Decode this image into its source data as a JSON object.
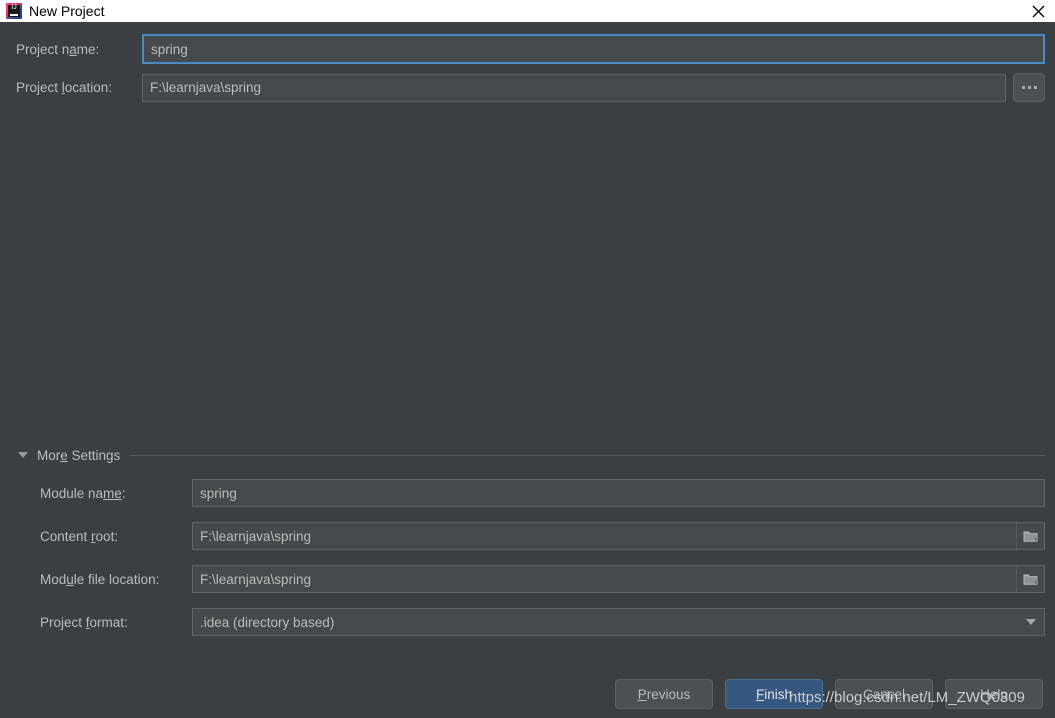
{
  "window": {
    "title": "New Project",
    "icon": "intellij-idea-icon",
    "close_label": "close-icon"
  },
  "top_form": {
    "project_name": {
      "label_before": "Project n",
      "label_mnemonic": "a",
      "label_after": "me:",
      "full_label": "Project name:",
      "value": "spring",
      "focused": true
    },
    "project_location": {
      "label_before": "Project ",
      "label_mnemonic": "l",
      "label_after": "ocation:",
      "full_label": "Project location:",
      "value": "F:\\learnjava\\spring"
    },
    "browse_button": {
      "label": "...",
      "name": "browse-button"
    }
  },
  "more_settings": {
    "label_before": "Mor",
    "label_mnemonic": "e",
    "label_after": " Settings",
    "full_label": "More Settings",
    "expanded": true,
    "rows": [
      {
        "label_before": "Module na",
        "label_mnemonic": "me",
        "label_after": ":",
        "full_label": "Module name:",
        "value": "spring",
        "control": "textfield"
      },
      {
        "label_before": "Content ",
        "label_mnemonic": "r",
        "label_after": "oot:",
        "full_label": "Content root:",
        "value": "F:\\learnjava\\spring",
        "control": "textfield-with-folder"
      },
      {
        "label_before": "Mod",
        "label_mnemonic": "u",
        "label_after": "le file location:",
        "full_label": "Module file location:",
        "value": "F:\\learnjava\\spring",
        "control": "textfield-with-folder"
      },
      {
        "label_before": "Project ",
        "label_mnemonic": "f",
        "label_after": "ormat:",
        "full_label": "Project format:",
        "value": ".idea (directory based)",
        "control": "combobox"
      }
    ]
  },
  "buttons": {
    "previous": {
      "label_before": "",
      "label_mnemonic": "P",
      "label_after": "revious",
      "full_label": "Previous"
    },
    "finish": {
      "label_before": "",
      "label_mnemonic": "F",
      "label_after": "inish",
      "full_label": "Finish"
    },
    "cancel": {
      "full_label": "Cancel"
    },
    "help": {
      "full_label": "Help"
    }
  },
  "watermark": {
    "text": "https://blog.csdn.net/LM_ZWQ0309"
  },
  "colors": {
    "background": "#3c3f41",
    "field_background": "#45494a",
    "focus_border": "#4a88c7",
    "primary_button": "#365880",
    "text": "#bbbbbb",
    "titlebar_background": "#ffffff"
  }
}
